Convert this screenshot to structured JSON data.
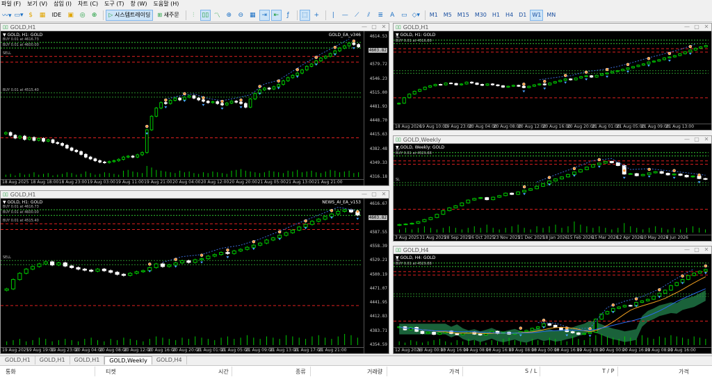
{
  "menu": [
    "파일 (F)",
    "보기 (V)",
    "삽입 (I)",
    "차트 (C)",
    "도구 (T)",
    "창 (W)",
    "도움말 (H)"
  ],
  "toolbar": {
    "ide_label": "IDE",
    "algo_trading_label": "시스템트레이딩",
    "new_order_label": "새주문",
    "timeframes": [
      "M1",
      "M5",
      "M15",
      "M30",
      "H1",
      "H4",
      "D1",
      "W1",
      "MN"
    ],
    "active_timeframe": "W1"
  },
  "windows": [
    {
      "id": "w1",
      "title": "GOLD,H1",
      "symbol_label": "GOLD, H1: GOLD",
      "ea_label": "GOLD_EA_v346",
      "prices": [
        "4614.53",
        "4603.82",
        "4579.72",
        "4546.23",
        "4515.00",
        "4481.93",
        "4448.70",
        "4415.63",
        "4382.48",
        "4349.33",
        "4316.18"
      ],
      "price_tag": "4603.82",
      "times": [
        "18 Aug 2025",
        "18 Aug 18:00",
        "18 Aug 23:00",
        "19 Aug 03:00",
        "19 Aug 11:00",
        "19 Aug 21:00",
        "20 Aug 04:00",
        "20 Aug 12:00",
        "20 Aug 20:00",
        "21 Aug 05:00",
        "21 Aug 13:00",
        "21 Aug 21:00"
      ],
      "order_labels": [
        "BUY 0.01 at 4616.73",
        "BUY 0.01 at 4600.00",
        "BUY 0.01 at 4515.40",
        "SELL"
      ],
      "closes": [
        4414,
        4408,
        4402,
        4406,
        4399,
        4403,
        4397,
        4401,
        4395,
        4398,
        4392,
        4390,
        4386,
        4380,
        4375,
        4372,
        4366,
        4360,
        4356,
        4352,
        4349,
        4348,
        4350,
        4352,
        4355,
        4360,
        4362,
        4360,
        4365,
        4370,
        4420,
        4450,
        4468,
        4480,
        4478,
        4485,
        4490,
        4486,
        4492,
        4495,
        4490,
        4486,
        4483,
        4480,
        4482,
        4478,
        4475,
        4479,
        4483,
        4481,
        4478,
        4470,
        4488,
        4500,
        4508,
        4512,
        4510,
        4515,
        4520,
        4528,
        4535,
        4540,
        4545,
        4552,
        4560,
        4565,
        4572,
        4578,
        4582,
        4588,
        4594,
        4600,
        4605,
        4611,
        4608,
        4603
      ],
      "volumes": [
        3,
        4,
        2,
        5,
        3,
        4,
        6,
        3,
        4,
        5,
        2,
        3,
        4,
        6,
        5,
        3,
        4,
        7,
        5,
        3,
        4,
        6,
        5,
        4,
        3,
        8,
        9,
        7,
        6,
        5,
        14,
        12,
        9,
        8,
        7,
        6,
        5,
        8,
        6,
        7,
        5,
        4,
        6,
        5,
        7,
        6,
        5,
        4,
        8,
        9,
        10,
        8,
        7,
        6,
        5,
        6,
        8,
        7,
        6,
        5,
        8,
        7,
        9,
        6,
        7,
        8,
        6,
        5,
        7,
        9,
        8,
        6,
        7,
        8,
        5,
        6
      ],
      "ymin": 4316,
      "ymax": 4625
    },
    {
      "id": "w2",
      "title": "GOLD,H1",
      "symbol_label": "GOLD, H1: GOLD",
      "ea_label": "",
      "prices": [],
      "price_tag": "",
      "times": [
        "18 Aug 2026",
        "19 Aug 10:00",
        "19 Aug 23:00",
        "20 Aug 04:00",
        "20 Aug 08:00",
        "20 Aug 12:00",
        "20 Aug 16:00",
        "20 Aug 20:00",
        "21 Aug 01:00",
        "21 Aug 05:00",
        "21 Aug 09:00",
        "21 Aug 13:00"
      ],
      "order_labels": [
        "SL",
        "BUY 0.01 at 4516.80"
      ],
      "closes": [
        4480,
        4492,
        4500,
        4506,
        4510,
        4515,
        4518,
        4521,
        4520,
        4524,
        4523,
        4520,
        4522,
        4526,
        4524,
        4521,
        4519,
        4522,
        4520,
        4518,
        4515,
        4517,
        4519,
        4517,
        4514,
        4517,
        4520,
        4522,
        4520,
        4524,
        4527,
        4530,
        4533,
        4531,
        4535,
        4538,
        4540,
        4537,
        4541,
        4544,
        4546,
        4549,
        4551,
        4554,
        4557,
        4560,
        4563,
        4566,
        4570,
        4572,
        4575,
        4579,
        4581,
        4584,
        4588,
        4592,
        4596,
        4600,
        4603,
        4606
      ],
      "volumes": [],
      "ymin": 4440,
      "ymax": 4625
    },
    {
      "id": "w3",
      "title": "GOLD,Weekly",
      "symbol_label": "GOLD, Weekly: GOLD",
      "ea_label": "",
      "prices": [],
      "price_tag": "",
      "times": [
        "3 Aug 2025",
        "31 Aug 2025",
        "28 Sep 2025",
        "26 Oct 2025",
        "23 Nov 2025",
        "21 Dec 2025",
        "18 Jan 2026",
        "15 Feb 2026",
        "15 Mar 2026",
        "12 Apr 2026",
        "10 May 2026",
        "7 Jun 2026"
      ],
      "order_labels": [
        "TP",
        "BUY 0.01 at 4529.88",
        "SL"
      ],
      "closes": [
        3350,
        3360,
        3380,
        3420,
        3470,
        3520,
        3600,
        3690,
        3760,
        3810,
        3880,
        3950,
        3990,
        4010,
        3960,
        4020,
        4060,
        4120,
        4090,
        4150,
        4190,
        4230,
        4290,
        4350,
        4420,
        4470,
        4520,
        4580,
        4640,
        4700,
        4760,
        4820,
        4860,
        4900,
        4870,
        4800,
        4590,
        4600,
        4550,
        4580,
        4620,
        4650,
        4610,
        4570,
        4590,
        4560,
        4520,
        4540,
        4480,
        4460
      ],
      "volumes": [
        2,
        3,
        2,
        3,
        4,
        3,
        2,
        3,
        4,
        3,
        2,
        3,
        4,
        3,
        5,
        3,
        2,
        3,
        4,
        5,
        3,
        2,
        4,
        3,
        4,
        5,
        3,
        4,
        7,
        5,
        4,
        3,
        4,
        3,
        2,
        3,
        6,
        4,
        3,
        2,
        3,
        4,
        3,
        2,
        3,
        2,
        3,
        4,
        3,
        2
      ],
      "ymin": 3150,
      "ymax": 5200
    },
    {
      "id": "w4",
      "title": "GOLD,H1",
      "symbol_label": "GOLD, H1: GOLD",
      "ea_label": "NEWS_AI_EA_v153",
      "prices": [
        "4616.67",
        "4603.82",
        "4587.55",
        "4558.39",
        "4529.21",
        "4500.19",
        "4471.07",
        "4441.95",
        "4412.83",
        "4383.71",
        "4354.59"
      ],
      "price_tag": "4603.82",
      "times": [
        "19 Aug 2025",
        "19 Aug 19:00",
        "19 Aug 23:00",
        "20 Aug 04:00",
        "20 Aug 08:00",
        "20 Aug 12:00",
        "20 Aug 16:00",
        "20 Aug 20:00",
        "21 Aug 01:00",
        "21 Aug 05:00",
        "21 Aug 09:00",
        "21 Aug 13:00",
        "21 Aug 17:00",
        "21 Aug 21:00"
      ],
      "order_labels": [
        "BUY 0.01 at 4616.73",
        "BUY 0.01 at 4600.00",
        "SELL",
        "BUY 0.01 at 4515.40"
      ],
      "closes": [
        4462,
        4480,
        4492,
        4500,
        4505,
        4510,
        4514,
        4508,
        4512,
        4506,
        4503,
        4500,
        4498,
        4496,
        4500,
        4497,
        4494,
        4490,
        4488,
        4492,
        4495,
        4497,
        4503,
        4510,
        4505,
        4508,
        4512,
        4516,
        4513,
        4518,
        4520,
        4525,
        4528,
        4532,
        4530,
        4535,
        4538,
        4542,
        4546,
        4550,
        4556,
        4560,
        4565,
        4570,
        4575,
        4581,
        4586,
        4592,
        4596,
        4601,
        4606,
        4611,
        4614,
        4610,
        4604
      ],
      "volumes": [
        3,
        4,
        5,
        3,
        4,
        6,
        5,
        3,
        4,
        5,
        4,
        3,
        5,
        6,
        4,
        3,
        5,
        4,
        6,
        5,
        4,
        3,
        5,
        7,
        6,
        5,
        4,
        6,
        5,
        7,
        6,
        5,
        4,
        6,
        7,
        5,
        6,
        8,
        6,
        5,
        7,
        6,
        5,
        8,
        7,
        6,
        5,
        7,
        8,
        6,
        5,
        7,
        9,
        8,
        6
      ],
      "ymin": 4354,
      "ymax": 4625
    },
    {
      "id": "w5",
      "title": "GOLD,H4",
      "symbol_label": "GOLD, H4: GOLD",
      "ea_label": "",
      "prices": [],
      "price_tag": "",
      "times": [
        "12 Aug 2026",
        "13 Aug 00:00",
        "13 Aug 16:00",
        "14 Aug 08:00",
        "16 Aug 16:00",
        "17 Aug 08:00",
        "18 Aug 00:00",
        "18 Aug 16:00",
        "19 Aug 08:00",
        "20 Aug 00:00",
        "20 Aug 16:00",
        "21 Aug 08:00",
        "21 Aug 16:00"
      ],
      "order_labels": [
        "SL",
        "BUY 0.01 at 4529.88"
      ],
      "closes": [
        4420,
        4410,
        4418,
        4405,
        4398,
        4402,
        4395,
        4400,
        4406,
        4398,
        4394,
        4399,
        4403,
        4396,
        4393,
        4400,
        4405,
        4398,
        4402,
        4396,
        4399,
        4404,
        4408,
        4415,
        4420,
        4430,
        4425,
        4418,
        4410,
        4404,
        4400,
        4395,
        4398,
        4402,
        4445,
        4462,
        4470,
        4480,
        4485,
        4490,
        4488,
        4500,
        4505,
        4510,
        4520,
        4530,
        4540,
        4555,
        4565,
        4575,
        4588,
        4596,
        4602,
        4608
      ],
      "volumes": [
        3,
        2,
        4,
        3,
        2,
        3,
        4,
        5,
        3,
        2,
        4,
        3,
        5,
        4,
        3,
        2,
        4,
        3,
        5,
        6,
        4,
        3,
        2,
        5,
        4,
        3,
        6,
        5,
        4,
        3,
        7,
        5,
        4,
        6,
        8,
        9,
        7,
        6,
        5,
        7,
        6,
        5,
        8,
        6,
        5,
        7,
        6,
        8,
        7,
        6,
        5,
        7,
        6,
        5
      ],
      "ymin": 4360,
      "ymax": 4640
    }
  ],
  "bottom_tabs": [
    "GOLD,H1",
    "GOLD,H1",
    "GOLD,H1",
    "GOLD,Weekly",
    "GOLD,H4"
  ],
  "active_bottom_tab": "GOLD,Weekly",
  "terminal_columns": [
    "통화",
    "티켓",
    "시간",
    "종류",
    "거래량",
    "가격",
    "S / L",
    "T / P",
    "가격"
  ],
  "colors": {
    "bull": "#00c800",
    "bear": "#ffffff",
    "buy_line": "#2a8f2a",
    "sl_line": "#e02020",
    "tp_line": "#33cc33",
    "grid_text": "#cfcfcf"
  }
}
